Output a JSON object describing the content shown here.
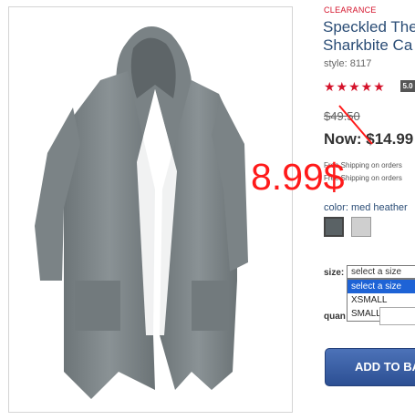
{
  "product": {
    "badge": "CLEARANCE",
    "title_line1": "Speckled The",
    "title_line2": "Sharkbite Ca",
    "style": "style: 8117",
    "stars": "★★★★★",
    "rating": "5.0",
    "was_price": "$49.50",
    "now_price": "Now: $14.99",
    "shipping_line1": "Free Shipping on orders",
    "shipping_line2": "Free Shipping on orders",
    "color_label": "color: med heather"
  },
  "annotation": {
    "price_note": "8.99$",
    "color": "#ff1a1a"
  },
  "size": {
    "label": "size:",
    "selected": "select a size",
    "options": [
      "select a size",
      "XSMALL",
      "SMALL"
    ]
  },
  "quantity": {
    "label": "quan"
  },
  "cart": {
    "button_label": "ADD TO BA"
  },
  "colors": {
    "accent_red": "#d4122a",
    "title_blue": "#2b4d76",
    "button_blue": "#2c4f93"
  }
}
